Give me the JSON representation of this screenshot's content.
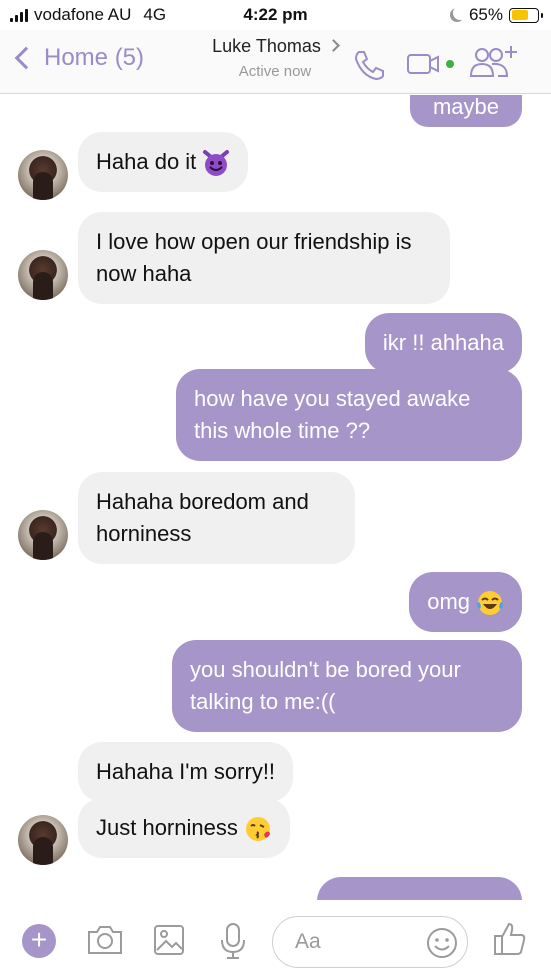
{
  "status_bar": {
    "carrier": "vodafone AU",
    "network": "4G",
    "time": "4:22 pm",
    "battery": "65%",
    "battery_level": 0.65
  },
  "header": {
    "back_label": "Home (5)",
    "contact_name": "Luke Thomas",
    "contact_status": "Active now",
    "icons": [
      "phone-icon",
      "video-camera-icon",
      "add-people-icon"
    ],
    "accent_color": "#9b8bc7"
  },
  "messages": [
    {
      "sender": "me",
      "text": "maybe"
    },
    {
      "sender": "them",
      "text": "Haha do it",
      "emoji": "smiling-devil"
    },
    {
      "sender": "them",
      "text": "I love how open our friendship is now haha"
    },
    {
      "sender": "me",
      "text": "ikr !! ahhaha"
    },
    {
      "sender": "me",
      "text": "how have you stayed awake this whole time ??"
    },
    {
      "sender": "them",
      "text": "Hahaha boredom and horniness"
    },
    {
      "sender": "me",
      "text": "omg",
      "emoji": "tears-of-joy"
    },
    {
      "sender": "me",
      "text": "you shouldn't be bored your talking to me:(("
    },
    {
      "sender": "them",
      "text": "Hahaha I'm sorry!!"
    },
    {
      "sender": "them",
      "text": "Just horniness",
      "emoji": "kissing-face"
    },
    {
      "sender": "me",
      "text": ""
    }
  ],
  "colors": {
    "outgoing_bubble": "#a595c8",
    "incoming_bubble": "#f0f0f0"
  },
  "composer": {
    "placeholder": "Aa",
    "icons": [
      "plus-icon",
      "camera-icon",
      "image-icon",
      "microphone-icon",
      "smiley-icon",
      "thumbs-up-icon"
    ]
  }
}
